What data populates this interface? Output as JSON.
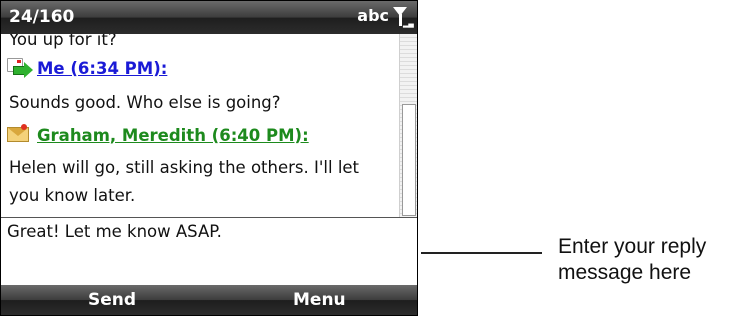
{
  "status_bar": {
    "char_count": "24/160",
    "input_mode": "abc",
    "signal_icon": "antenna-signal-icon"
  },
  "conversation": {
    "partial_line": "You up for it?",
    "messages": [
      {
        "sender": "Me (6:34 PM):",
        "icon": "sent-message-icon",
        "sender_color": "#1a1ad6",
        "lines": [
          "Sounds good. Who else is going?"
        ]
      },
      {
        "sender": "Graham, Meredith (6:40 PM):",
        "icon": "received-envelope-icon",
        "sender_color": "#1d8a1d",
        "lines": [
          "Helen will go, still asking the others. I'll let",
          "you know later."
        ]
      }
    ]
  },
  "reply": {
    "text": "Great! Let me know ASAP."
  },
  "softkeys": {
    "left": "Send",
    "right": "Menu"
  },
  "callout": {
    "line1": "Enter your reply",
    "line2": "message here"
  }
}
